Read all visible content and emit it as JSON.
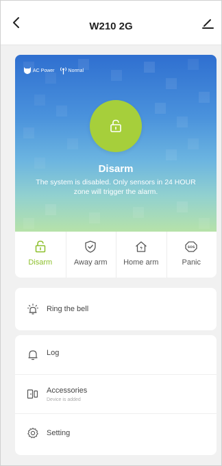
{
  "header": {
    "title": "W210 2G"
  },
  "hero": {
    "power_label": "AC Power",
    "signal_label": "Normal",
    "state_title": "Disarm",
    "state_desc": "The system is disabled. Only sensors in 24 HOUR zone will trigger the alarm."
  },
  "modes": [
    {
      "label": "Disarm",
      "icon": "unlock-icon",
      "active": true
    },
    {
      "label": "Away arm",
      "icon": "shield-check-icon",
      "active": false
    },
    {
      "label": "Home arm",
      "icon": "home-bolt-icon",
      "active": false
    },
    {
      "label": "Panic",
      "icon": "sos-icon",
      "active": false
    }
  ],
  "bell": {
    "label": "Ring the bell",
    "icon": "bell-ring-icon"
  },
  "menu": {
    "log_label": "Log",
    "accessories_label": "Accessories",
    "accessories_sub": "Device is added",
    "setting_label": "Setting"
  },
  "colors": {
    "accent": "#8cbf2a",
    "lock_circle": "#a6cf3b",
    "hero_top": "#2f6fd0",
    "hero_bottom": "#b6e2a9"
  }
}
